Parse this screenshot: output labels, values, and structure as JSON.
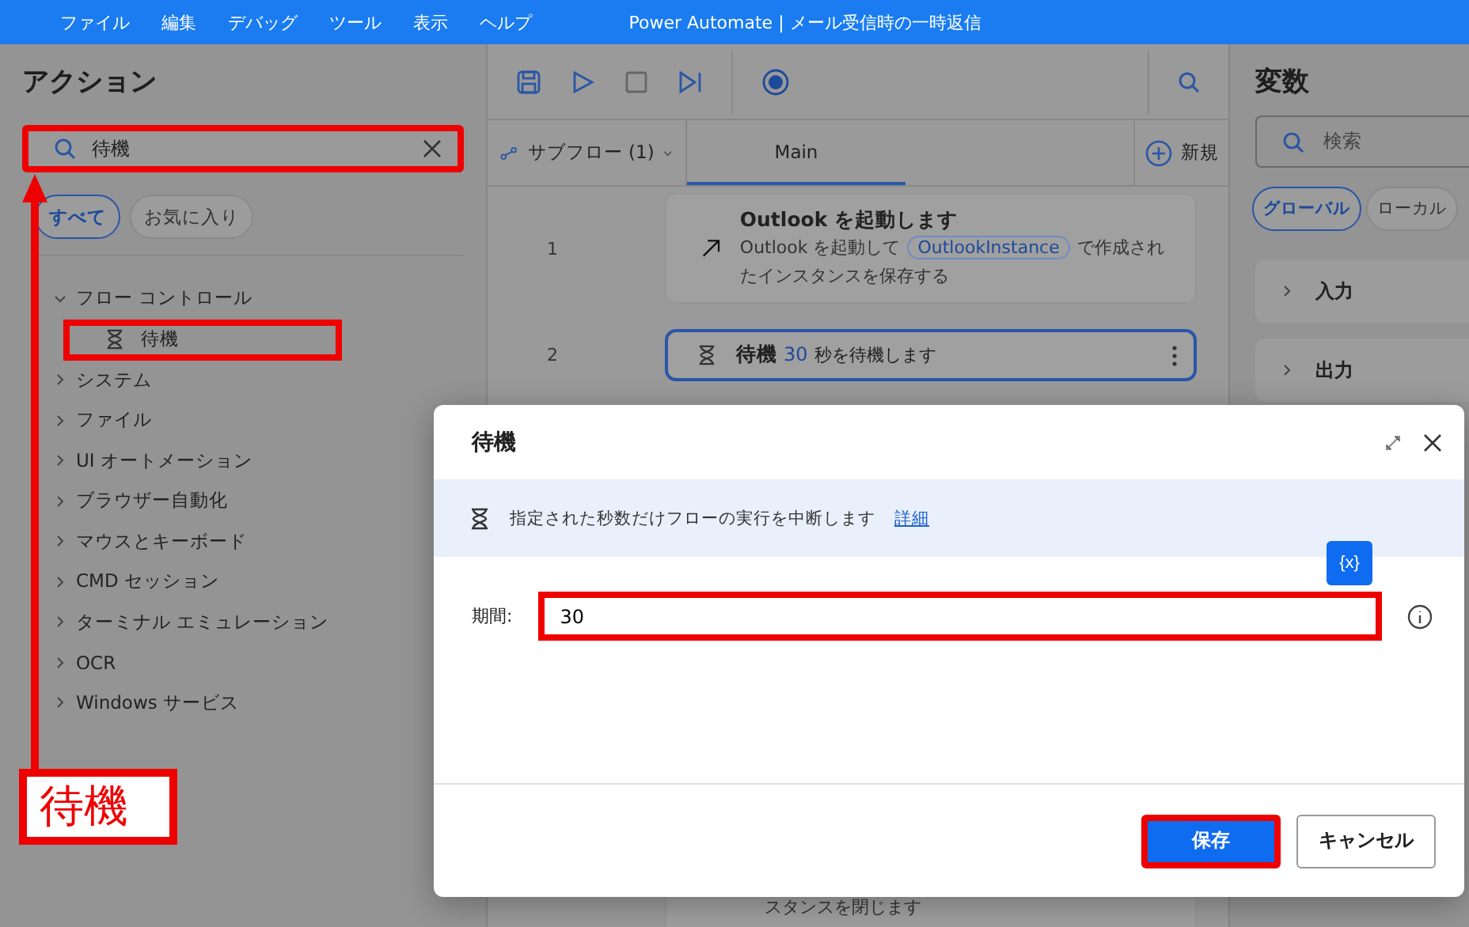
{
  "title_bar": {
    "menu": [
      "ファイル",
      "編集",
      "デバッグ",
      "ツール",
      "表示",
      "ヘルプ"
    ],
    "title": "Power Automate | メール受信時の一時返信"
  },
  "actions_panel": {
    "title": "アクション",
    "search": {
      "value": "待機",
      "highlighted": true
    },
    "filters": [
      {
        "label": "すべて",
        "selected": true
      },
      {
        "label": "お気に入り",
        "selected": false
      }
    ],
    "tree": [
      {
        "label": "フロー コントロール",
        "expanded": true,
        "children": [
          {
            "label": "待機",
            "highlighted": true
          }
        ]
      },
      {
        "label": "システム",
        "expanded": false
      },
      {
        "label": "ファイル",
        "expanded": false
      },
      {
        "label": "UI オートメーション",
        "expanded": false
      },
      {
        "label": "ブラウザー自動化",
        "expanded": false
      },
      {
        "label": "マウスとキーボード",
        "expanded": false
      },
      {
        "label": "CMD セッション",
        "expanded": false
      },
      {
        "label": "ターミナル エミュレーション",
        "expanded": false
      },
      {
        "label": "OCR",
        "expanded": false
      },
      {
        "label": "Windows サービス",
        "expanded": false
      }
    ]
  },
  "flow": {
    "subflow": "サブフロー (1)",
    "tabs": [
      {
        "label": "Main",
        "selected": true
      }
    ],
    "new_button": "新規",
    "steps": [
      {
        "number": "1",
        "kind": "launch",
        "selected": false,
        "title": "Outlook を起動します",
        "text_before": "Outlook を起動して",
        "variable": "OutlookInstance",
        "text_after": "で作成されたインスタンスを保存する"
      },
      {
        "number": "2",
        "kind": "wait",
        "selected": true,
        "title": "待機",
        "param": "30",
        "text_after": "秒を待機します"
      },
      {
        "kind": "partial",
        "selected": false,
        "text_after": "スタンスを閉じます"
      }
    ]
  },
  "variables_panel": {
    "title": "変数",
    "search": {
      "placeholder": "検索"
    },
    "filters": [
      {
        "label": "グローバル",
        "selected": true
      },
      {
        "label": "ローカル",
        "selected": false
      }
    ],
    "sections": [
      "入力",
      "出力"
    ]
  },
  "dialog": {
    "title": "待機",
    "description": "指定された秒数だけフローの実行を中断します",
    "link": "詳細",
    "variable_button": "{x}",
    "field": {
      "label": "期間:",
      "value": "30",
      "highlighted": true
    },
    "buttons": [
      {
        "label": "保存",
        "kind": "primary",
        "highlighted": true
      },
      {
        "label": "キャンセル",
        "kind": "secondary",
        "highlighted": false
      }
    ]
  },
  "annotation": {
    "label": "待機"
  }
}
